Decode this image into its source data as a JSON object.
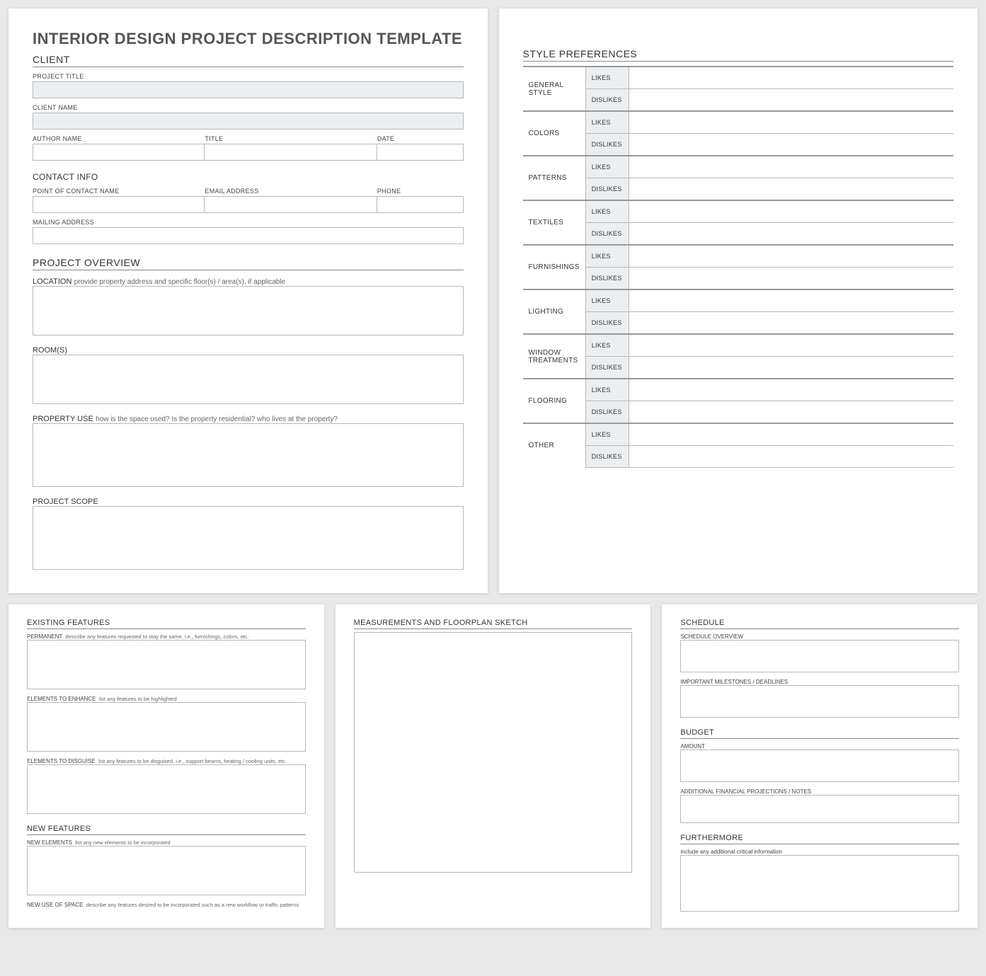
{
  "title": "INTERIOR DESIGN PROJECT DESCRIPTION TEMPLATE",
  "client": {
    "heading": "CLIENT",
    "project_title_lbl": "PROJECT TITLE",
    "client_name_lbl": "CLIENT NAME",
    "author_name_lbl": "AUTHOR NAME",
    "title_lbl": "TITLE",
    "date_lbl": "DATE",
    "contact_heading": "CONTACT INFO",
    "poc_lbl": "POINT OF CONTACT NAME",
    "email_lbl": "EMAIL ADDRESS",
    "phone_lbl": "PHONE",
    "mailing_lbl": "MAILING ADDRESS"
  },
  "overview": {
    "heading": "PROJECT OVERVIEW",
    "location_lbl": "LOCATION",
    "location_hint": "provide property address and specific floor(s) / area(s), if applicable",
    "rooms_lbl": "ROOM(S)",
    "use_lbl": "PROPERTY USE",
    "use_hint": "how is the space used?  Is the property residential? who lives at the property?",
    "scope_lbl": "PROJECT SCOPE"
  },
  "style": {
    "heading": "STYLE PREFERENCES",
    "likes": "LIKES",
    "dislikes": "DISLIKES",
    "rows": {
      "general": "GENERAL STYLE",
      "colors": "COLORS",
      "patterns": "PATTERNS",
      "textiles": "TEXTILES",
      "furnishings": "FURNISHINGS",
      "lighting": "LIGHTING",
      "window": "WINDOW TREATMENTS",
      "flooring": "FLOORING",
      "other": "OTHER"
    }
  },
  "existing": {
    "heading": "EXISTING FEATURES",
    "permanent_lbl": "PERMANENT",
    "permanent_hint": "describe any features requested to stay the same, i.e., furnishings, colors, etc.",
    "enhance_lbl": "ELEMENTS TO ENHANCE",
    "enhance_hint": "list any features to be highlighted",
    "disguise_lbl": "ELEMENTS TO DISGUISE",
    "disguise_hint": "list any features to be disguised, i.e., support beams, heating / cooling units, etc.",
    "new_heading": "NEW FEATURES",
    "new_elements_lbl": "NEW ELEMENTS",
    "new_elements_hint": "list any new elements to be incorporated",
    "new_use_lbl": "NEW USE OF SPACE",
    "new_use_hint": "describe any features desired to be incorporated such as a new workflow or traffic patterns"
  },
  "measure": {
    "heading": "MEASUREMENTS AND FLOORPLAN SKETCH"
  },
  "schedule": {
    "heading": "SCHEDULE",
    "overview_lbl": "SCHEDULE OVERVIEW",
    "milestones_lbl": "IMPORTANT MILESTONES / DEADLINES",
    "budget_heading": "BUDGET",
    "amount_lbl": "AMOUNT",
    "notes_lbl": "ADDITIONAL FINANCIAL PROJECTIONS / NOTES",
    "furthermore_heading": "FURTHERMORE",
    "furthermore_hint": "include any additional critical information"
  }
}
